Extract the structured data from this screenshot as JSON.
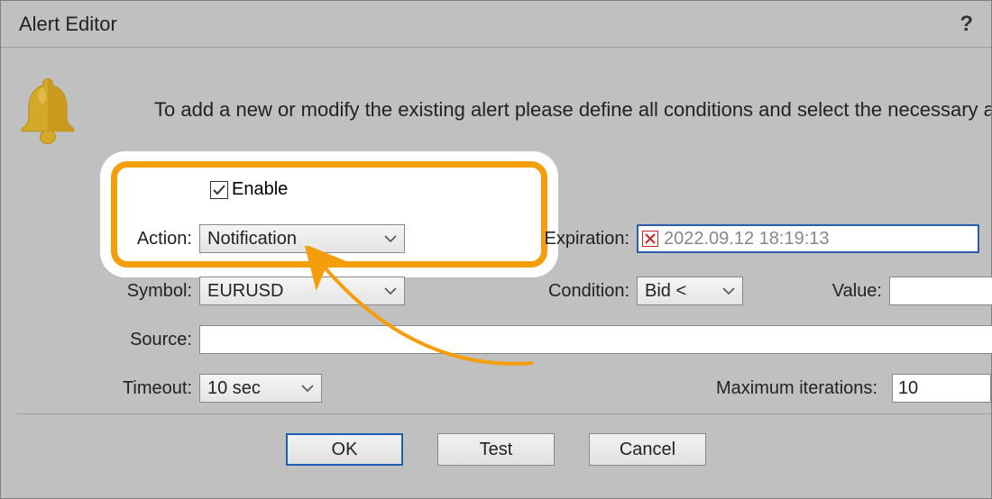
{
  "window": {
    "title": "Alert Editor",
    "help": "?"
  },
  "intro": "To add a new or modify the existing alert please define all conditions and select the necessary act",
  "fields": {
    "enable_label": "Enable",
    "enable_checked": true,
    "action_label": "Action:",
    "action_value": "Notification",
    "expiration_label": "Expiration:",
    "expiration_value": "2022.09.12 18:19:13",
    "symbol_label": "Symbol:",
    "symbol_value": "EURUSD",
    "condition_label": "Condition:",
    "condition_value": "Bid <",
    "value_label": "Value:",
    "value_value": "",
    "source_label": "Source:",
    "source_value": "",
    "timeout_label": "Timeout:",
    "timeout_value": "10 sec",
    "maxiter_label": "Maximum iterations:",
    "maxiter_value": "10"
  },
  "buttons": {
    "ok": "OK",
    "test": "Test",
    "cancel": "Cancel"
  }
}
